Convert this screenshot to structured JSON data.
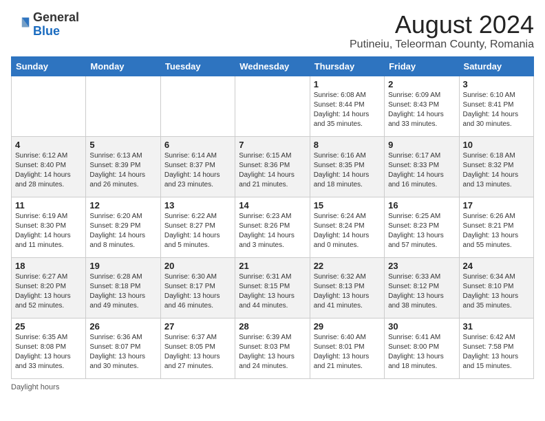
{
  "header": {
    "logo_general": "General",
    "logo_blue": "Blue",
    "month_year": "August 2024",
    "location": "Putineiu, Teleorman County, Romania"
  },
  "calendar": {
    "days_of_week": [
      "Sunday",
      "Monday",
      "Tuesday",
      "Wednesday",
      "Thursday",
      "Friday",
      "Saturday"
    ],
    "weeks": [
      [
        {
          "day": "",
          "info": ""
        },
        {
          "day": "",
          "info": ""
        },
        {
          "day": "",
          "info": ""
        },
        {
          "day": "",
          "info": ""
        },
        {
          "day": "1",
          "info": "Sunrise: 6:08 AM\nSunset: 8:44 PM\nDaylight: 14 hours\nand 35 minutes."
        },
        {
          "day": "2",
          "info": "Sunrise: 6:09 AM\nSunset: 8:43 PM\nDaylight: 14 hours\nand 33 minutes."
        },
        {
          "day": "3",
          "info": "Sunrise: 6:10 AM\nSunset: 8:41 PM\nDaylight: 14 hours\nand 30 minutes."
        }
      ],
      [
        {
          "day": "4",
          "info": "Sunrise: 6:12 AM\nSunset: 8:40 PM\nDaylight: 14 hours\nand 28 minutes."
        },
        {
          "day": "5",
          "info": "Sunrise: 6:13 AM\nSunset: 8:39 PM\nDaylight: 14 hours\nand 26 minutes."
        },
        {
          "day": "6",
          "info": "Sunrise: 6:14 AM\nSunset: 8:37 PM\nDaylight: 14 hours\nand 23 minutes."
        },
        {
          "day": "7",
          "info": "Sunrise: 6:15 AM\nSunset: 8:36 PM\nDaylight: 14 hours\nand 21 minutes."
        },
        {
          "day": "8",
          "info": "Sunrise: 6:16 AM\nSunset: 8:35 PM\nDaylight: 14 hours\nand 18 minutes."
        },
        {
          "day": "9",
          "info": "Sunrise: 6:17 AM\nSunset: 8:33 PM\nDaylight: 14 hours\nand 16 minutes."
        },
        {
          "day": "10",
          "info": "Sunrise: 6:18 AM\nSunset: 8:32 PM\nDaylight: 14 hours\nand 13 minutes."
        }
      ],
      [
        {
          "day": "11",
          "info": "Sunrise: 6:19 AM\nSunset: 8:30 PM\nDaylight: 14 hours\nand 11 minutes."
        },
        {
          "day": "12",
          "info": "Sunrise: 6:20 AM\nSunset: 8:29 PM\nDaylight: 14 hours\nand 8 minutes."
        },
        {
          "day": "13",
          "info": "Sunrise: 6:22 AM\nSunset: 8:27 PM\nDaylight: 14 hours\nand 5 minutes."
        },
        {
          "day": "14",
          "info": "Sunrise: 6:23 AM\nSunset: 8:26 PM\nDaylight: 14 hours\nand 3 minutes."
        },
        {
          "day": "15",
          "info": "Sunrise: 6:24 AM\nSunset: 8:24 PM\nDaylight: 14 hours\nand 0 minutes."
        },
        {
          "day": "16",
          "info": "Sunrise: 6:25 AM\nSunset: 8:23 PM\nDaylight: 13 hours\nand 57 minutes."
        },
        {
          "day": "17",
          "info": "Sunrise: 6:26 AM\nSunset: 8:21 PM\nDaylight: 13 hours\nand 55 minutes."
        }
      ],
      [
        {
          "day": "18",
          "info": "Sunrise: 6:27 AM\nSunset: 8:20 PM\nDaylight: 13 hours\nand 52 minutes."
        },
        {
          "day": "19",
          "info": "Sunrise: 6:28 AM\nSunset: 8:18 PM\nDaylight: 13 hours\nand 49 minutes."
        },
        {
          "day": "20",
          "info": "Sunrise: 6:30 AM\nSunset: 8:17 PM\nDaylight: 13 hours\nand 46 minutes."
        },
        {
          "day": "21",
          "info": "Sunrise: 6:31 AM\nSunset: 8:15 PM\nDaylight: 13 hours\nand 44 minutes."
        },
        {
          "day": "22",
          "info": "Sunrise: 6:32 AM\nSunset: 8:13 PM\nDaylight: 13 hours\nand 41 minutes."
        },
        {
          "day": "23",
          "info": "Sunrise: 6:33 AM\nSunset: 8:12 PM\nDaylight: 13 hours\nand 38 minutes."
        },
        {
          "day": "24",
          "info": "Sunrise: 6:34 AM\nSunset: 8:10 PM\nDaylight: 13 hours\nand 35 minutes."
        }
      ],
      [
        {
          "day": "25",
          "info": "Sunrise: 6:35 AM\nSunset: 8:08 PM\nDaylight: 13 hours\nand 33 minutes."
        },
        {
          "day": "26",
          "info": "Sunrise: 6:36 AM\nSunset: 8:07 PM\nDaylight: 13 hours\nand 30 minutes."
        },
        {
          "day": "27",
          "info": "Sunrise: 6:37 AM\nSunset: 8:05 PM\nDaylight: 13 hours\nand 27 minutes."
        },
        {
          "day": "28",
          "info": "Sunrise: 6:39 AM\nSunset: 8:03 PM\nDaylight: 13 hours\nand 24 minutes."
        },
        {
          "day": "29",
          "info": "Sunrise: 6:40 AM\nSunset: 8:01 PM\nDaylight: 13 hours\nand 21 minutes."
        },
        {
          "day": "30",
          "info": "Sunrise: 6:41 AM\nSunset: 8:00 PM\nDaylight: 13 hours\nand 18 minutes."
        },
        {
          "day": "31",
          "info": "Sunrise: 6:42 AM\nSunset: 7:58 PM\nDaylight: 13 hours\nand 15 minutes."
        }
      ]
    ]
  },
  "footer": {
    "daylight_label": "Daylight hours"
  }
}
